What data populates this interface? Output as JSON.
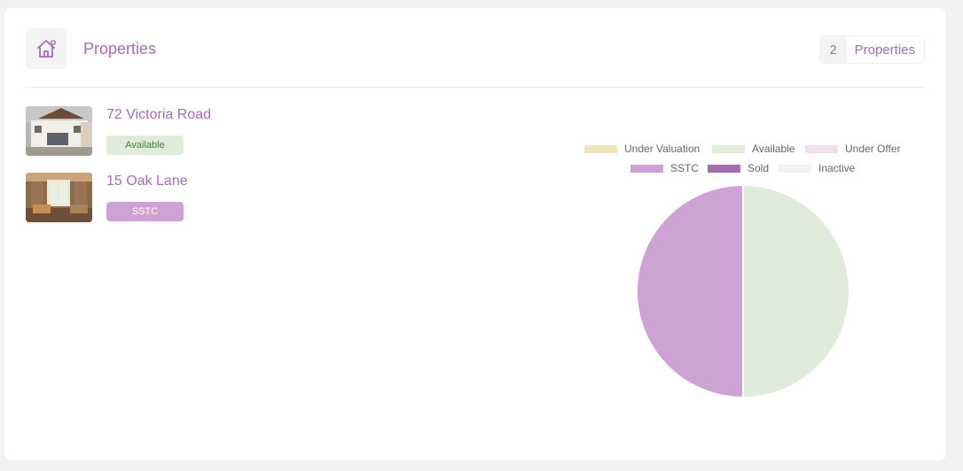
{
  "header": {
    "title": "Properties",
    "count": "2",
    "count_label": "Properties",
    "icon": "house-icon"
  },
  "properties": [
    {
      "name": "72 Victoria Road",
      "status": "Available"
    },
    {
      "name": "15 Oak Lane",
      "status": "SSTC"
    }
  ],
  "chart_data": {
    "type": "pie",
    "legend_position": "top",
    "legend": [
      {
        "name": "Under Valuation",
        "color": "#f0e5ba"
      },
      {
        "name": "Available",
        "color": "#e0ecda"
      },
      {
        "name": "Under Offer",
        "color": "#efe0ef"
      },
      {
        "name": "SSTC",
        "color": "#cfa2d6"
      },
      {
        "name": "Sold",
        "color": "#a56cb6"
      },
      {
        "name": "Inactive",
        "color": "#f3f3f3"
      }
    ],
    "categories": [
      "Under Valuation",
      "Available",
      "Under Offer",
      "SSTC",
      "Sold",
      "Inactive"
    ],
    "values": [
      0,
      1,
      0,
      1,
      0,
      0
    ]
  }
}
